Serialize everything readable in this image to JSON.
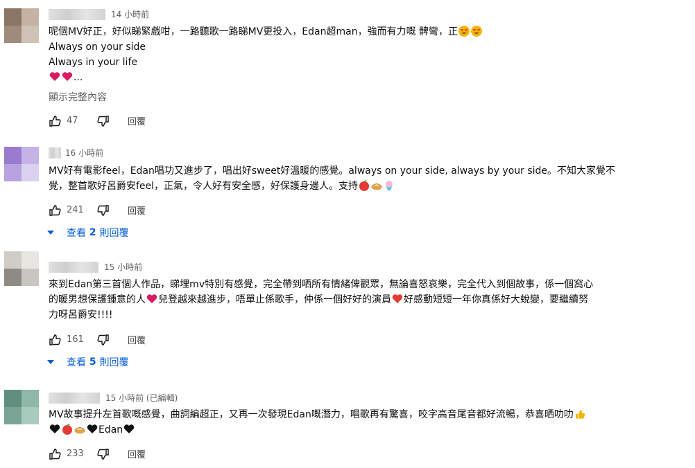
{
  "comments": [
    {
      "time": "14 小時前",
      "lines": [
        "呢個MV好正，好似睇緊戲咁，一路聽歌一路睇MV更投入，Edan超man，強而有力嘅 髀彎，正",
        "Always on your side",
        "Always in your life",
        "..."
      ],
      "show_more": "顯示完整內容",
      "likes": "47",
      "reply_label": "回覆",
      "avatar_colors": [
        "#8b7565",
        "#c4b3a5",
        "#a08a7b",
        "#cfc2b6"
      ]
    },
    {
      "time": "16 小時前",
      "lines": [
        "MV好有電影feel，Edan唱功又進步了，唱出好sweet好溫暖的感覺。always on your side, always by your side。不知大家覺不",
        "覺，整首歌好呂爵安feel，正氣，令人好有安全感，好保護身邊人。支持"
      ],
      "likes": "241",
      "reply_label": "回覆",
      "view_replies_prefix": "查看",
      "view_replies_count": "2",
      "view_replies_suffix": "則回覆",
      "avatar_colors": [
        "#9a7bd0",
        "#c5b3e8",
        "#b8a2df",
        "#ddd1f2"
      ]
    },
    {
      "time": "15 小時前",
      "lines": [
        "來到Edan第三首個人作品，睇埋mv特別有感覺，完全帶到哂所有情緒俾觀眾，無論喜怒哀樂，完全代入到個故事，係一個窩心",
        "的暖男想保護鍾意的人",
        "兒登越來越進步，唔單止係歌手，仲係一個好好的演員",
        "好感動短短一年你真係好大蛻變，要繼續努",
        "力呀呂爵安!!!!"
      ],
      "likes": "161",
      "reply_label": "回覆",
      "view_replies_prefix": "查看",
      "view_replies_count": "5",
      "view_replies_suffix": "則回覆",
      "avatar_colors": [
        "#d0ccc8",
        "#e8e6e3",
        "#8f8a85",
        "#c9c5c1"
      ]
    },
    {
      "time": "15 小時前 (已編輯)",
      "lines": [
        "MV故事提升左首歌嘅感覺，曲詞編超正，又再一次發現Edan嘅潛力，唱歌再有驚喜，咬字高音尾音都好流暢，恭喜晒叻叻",
        "Edan"
      ],
      "likes": "233",
      "reply_label": "回覆",
      "avatar_colors": [
        "#5f8f7f",
        "#8fb8a8",
        "#7aa596",
        "#a9cbbd"
      ]
    }
  ],
  "colors": {
    "link": "#065fd4",
    "secondary": "#606060",
    "text": "#0f0f0f"
  }
}
